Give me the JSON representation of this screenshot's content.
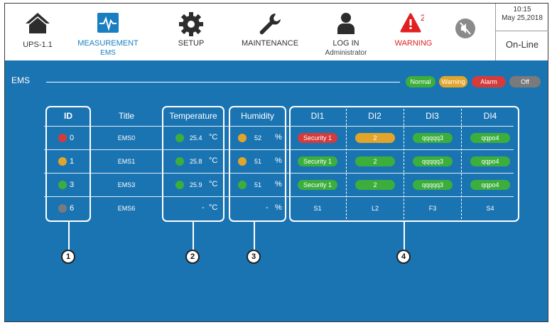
{
  "nav": {
    "ups_label": "UPS-1.1",
    "measurement_label": "MEASUREMENT",
    "measurement_sub": "EMS",
    "setup_label": "SETUP",
    "maintenance_label": "MAINTENANCE",
    "login_label": "LOG IN",
    "login_sub": "Administrator",
    "warning_label": "WARNING",
    "warning_count": "2"
  },
  "clock": {
    "time": "10:15",
    "date": "May 25,2018",
    "status": "On-Line"
  },
  "panel": {
    "title": "EMS"
  },
  "legend": [
    {
      "label": "Normal",
      "color": "#3cae3c"
    },
    {
      "label": "Warning",
      "color": "#e2a52b"
    },
    {
      "label": "Alarm",
      "color": "#d43b3b"
    },
    {
      "label": "Off",
      "color": "#7a7a7a"
    }
  ],
  "table": {
    "headers": {
      "id": "ID",
      "title": "Title",
      "temperature": "Temperature",
      "humidity": "Humidity",
      "di1": "DI1",
      "di2": "DI2",
      "di3": "DI3",
      "di4": "DI4"
    },
    "rows": [
      {
        "id": "0",
        "id_color": "#d43b3b",
        "title": "EMS0",
        "temp": "25.4",
        "temp_unit": "°C",
        "temp_color": "#3cae3c",
        "hum": "52",
        "hum_unit": "%",
        "hum_color": "#e2a52b",
        "di": [
          {
            "text": "Security 1",
            "color": "#d43b3b"
          },
          {
            "text": "2",
            "color": "#e2a52b"
          },
          {
            "text": "qqqqq3",
            "color": "#3cae3c"
          },
          {
            "text": "qqpo4",
            "color": "#3cae3c"
          }
        ]
      },
      {
        "id": "1",
        "id_color": "#e2a52b",
        "title": "EMS1",
        "temp": "25.8",
        "temp_unit": "°C",
        "temp_color": "#3cae3c",
        "hum": "51",
        "hum_unit": "%",
        "hum_color": "#e2a52b",
        "di": [
          {
            "text": "Security 1",
            "color": "#3cae3c"
          },
          {
            "text": "2",
            "color": "#3cae3c"
          },
          {
            "text": "qqqqq3",
            "color": "#3cae3c"
          },
          {
            "text": "qqpo4",
            "color": "#3cae3c"
          }
        ]
      },
      {
        "id": "3",
        "id_color": "#3cae3c",
        "title": "EMS3",
        "temp": "25.9",
        "temp_unit": "°C",
        "temp_color": "#3cae3c",
        "hum": "51",
        "hum_unit": "%",
        "hum_color": "#3cae3c",
        "di": [
          {
            "text": "Security 1",
            "color": "#3cae3c"
          },
          {
            "text": "2",
            "color": "#3cae3c"
          },
          {
            "text": "qqqqq3",
            "color": "#3cae3c"
          },
          {
            "text": "qqpo4",
            "color": "#3cae3c"
          }
        ]
      },
      {
        "id": "6",
        "id_color": "#7a7a7a",
        "title": "EMS6",
        "temp": "-",
        "temp_unit": "°C",
        "hum": "-",
        "hum_unit": "%",
        "di": [
          {
            "text": "S1"
          },
          {
            "text": "L2"
          },
          {
            "text": "F3"
          },
          {
            "text": "S4"
          }
        ]
      }
    ]
  },
  "callouts": [
    "1",
    "2",
    "3",
    "4"
  ]
}
